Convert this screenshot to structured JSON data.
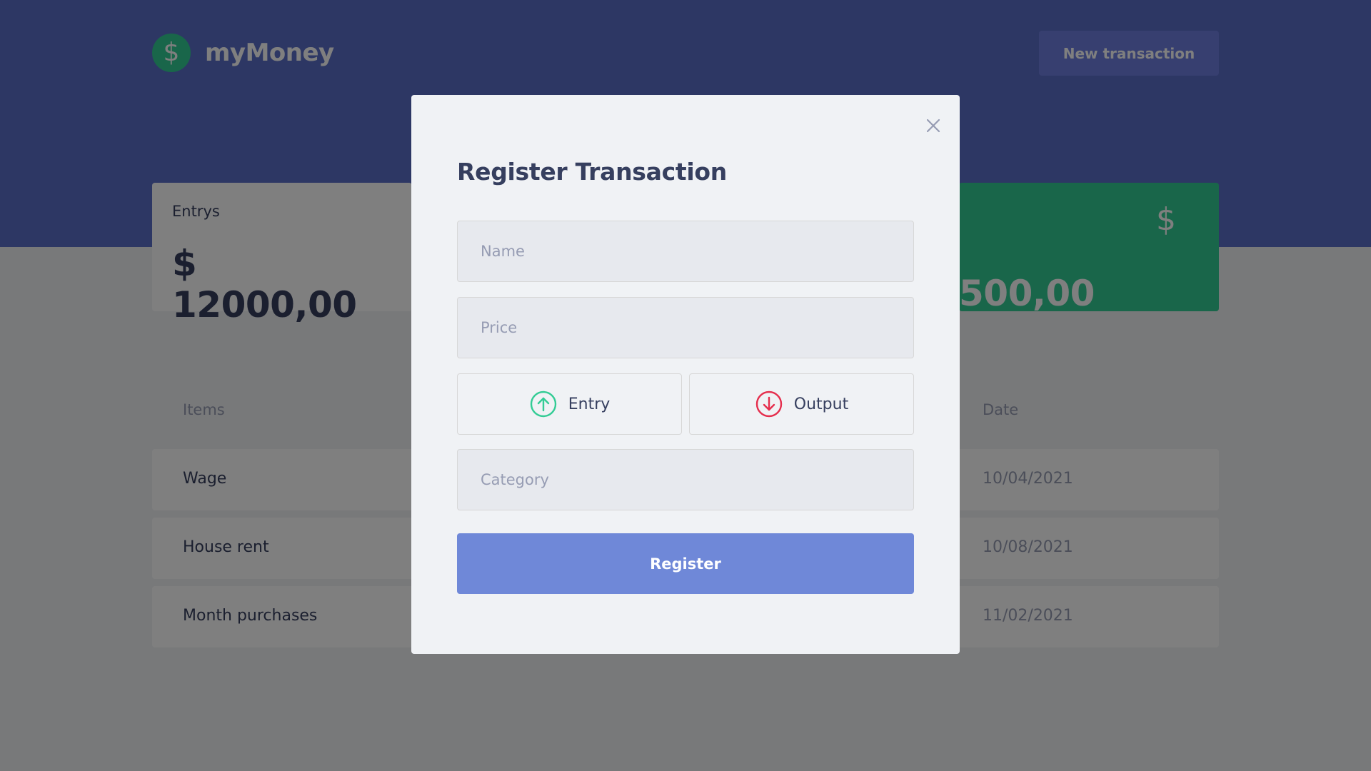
{
  "app": {
    "logo_symbol": "$",
    "logo_text": "myMoney"
  },
  "header": {
    "new_transaction_label": "New transaction"
  },
  "summary": {
    "entrys_label": "Entrys",
    "entrys_value": "$ 12000,00",
    "total_value_partial": "500,00",
    "total_icon": "dollar-icon",
    "total_symbol": "$"
  },
  "table": {
    "headers": {
      "items": "Items",
      "date": "Date"
    },
    "rows": [
      {
        "name": "Wage",
        "date": "10/04/2021"
      },
      {
        "name": "House rent",
        "date": "10/08/2021"
      },
      {
        "name": "Month purchases",
        "date": "11/02/2021"
      }
    ]
  },
  "modal": {
    "title": "Register Transaction",
    "close_icon": "close-icon",
    "name_placeholder": "Name",
    "price_placeholder": "Price",
    "category_placeholder": "Category",
    "entry_label": "Entry",
    "entry_icon": "arrow-up-circle-icon",
    "output_label": "Output",
    "output_icon": "arrow-down-circle-icon",
    "register_label": "Register"
  },
  "colors": {
    "header_bg": "#5a6fc8",
    "green": "#33cc95",
    "red": "#e52e4d",
    "register_bg": "#6f88d8",
    "text": "#363f5f",
    "muted": "#969cb3"
  }
}
